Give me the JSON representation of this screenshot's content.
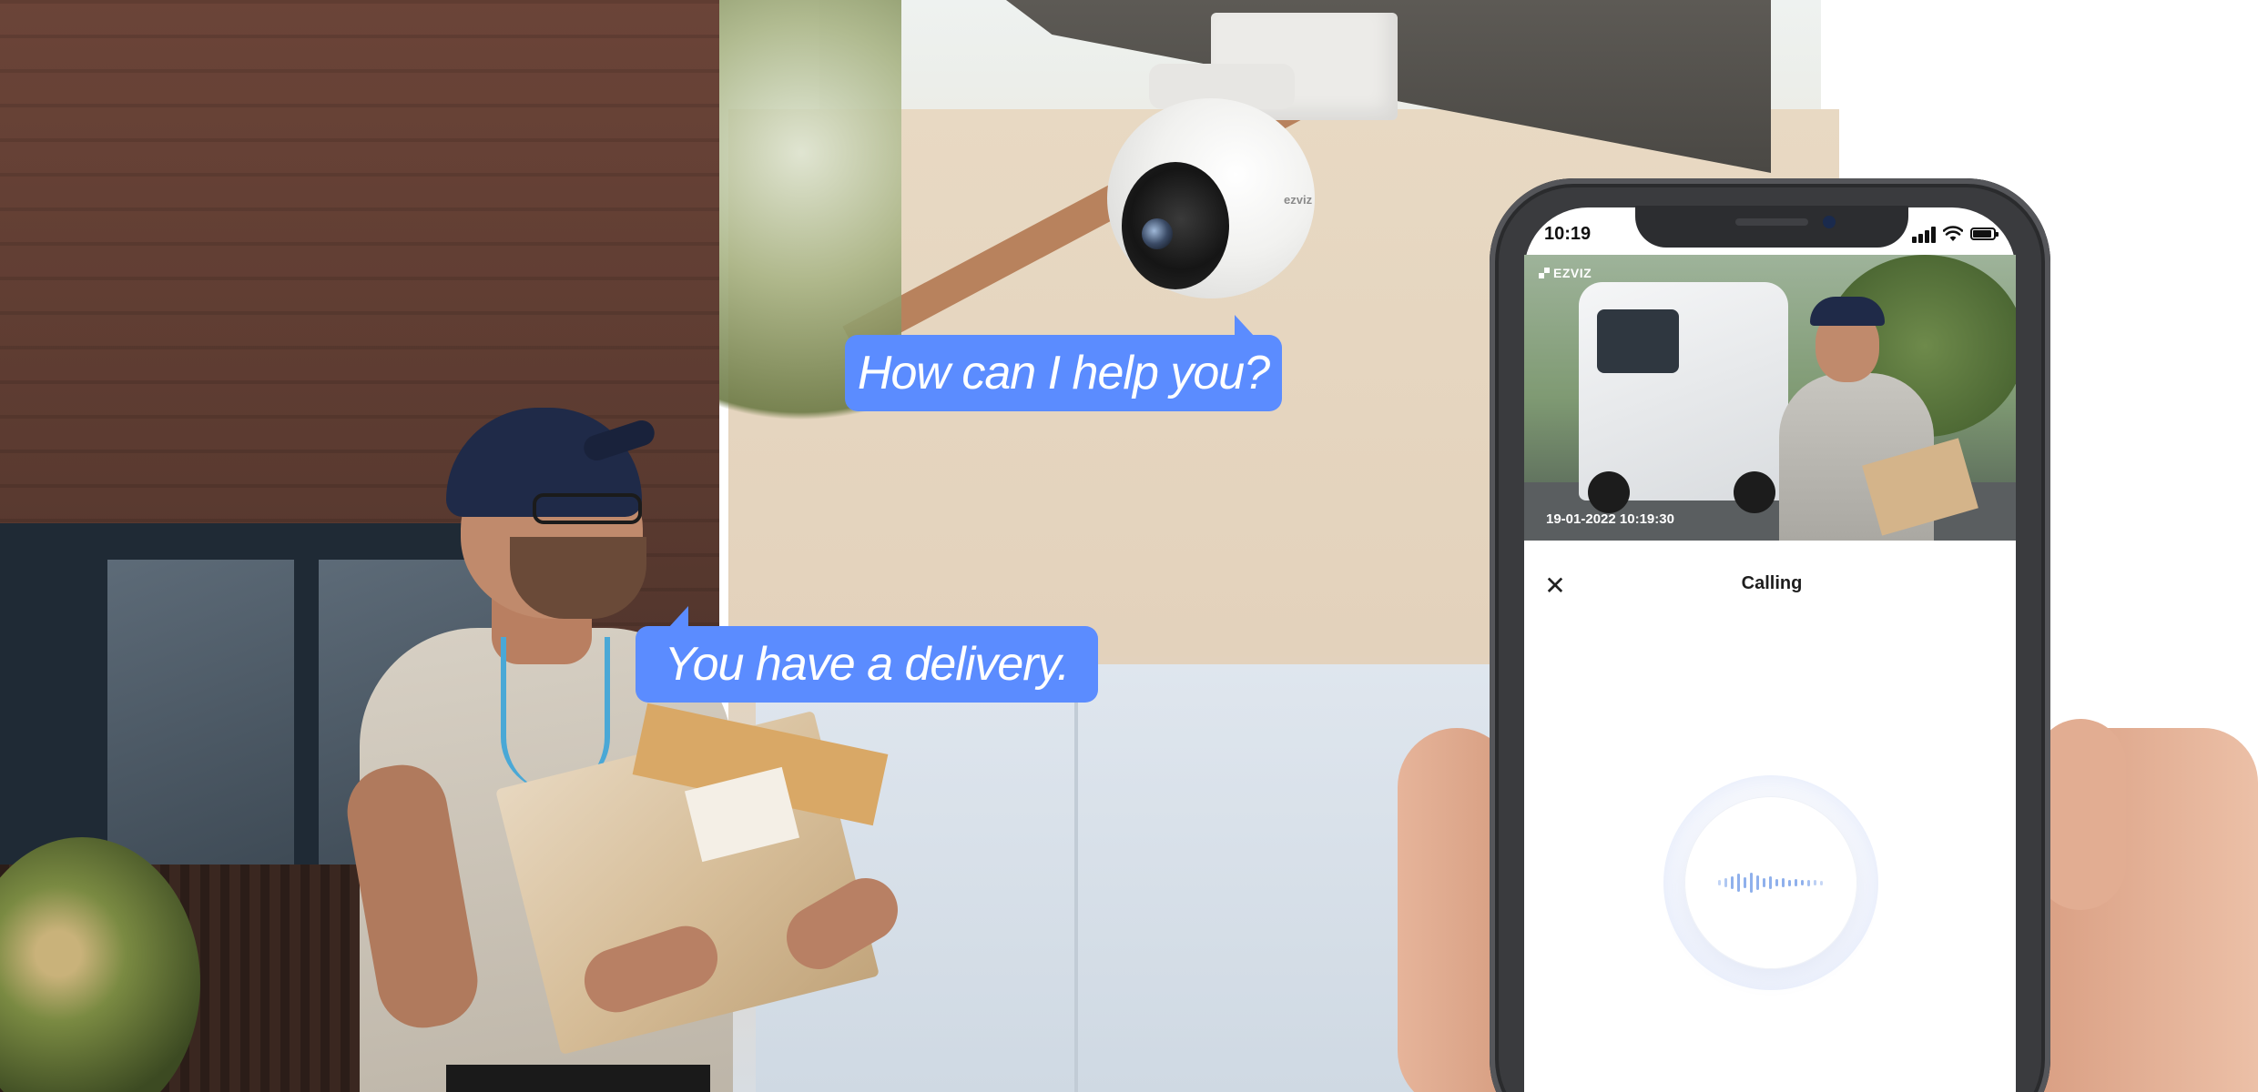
{
  "bubbles": {
    "camera_line": "How can I help you?",
    "visitor_line": "You have a delivery."
  },
  "camera": {
    "logo": "ezviz"
  },
  "phone": {
    "status_bar": {
      "time": "10:19"
    },
    "feed": {
      "logo": "EZVIZ",
      "timestamp": "19-01-2022 10:19:30"
    },
    "call": {
      "title": "Calling",
      "close_glyph": "✕"
    }
  },
  "colors": {
    "bubble": "#5b8cff",
    "voice_wave": "#8fb0ec"
  },
  "icons": [
    "close-icon",
    "signal-icon",
    "wifi-icon",
    "battery-icon",
    "voice-wave-icon"
  ]
}
